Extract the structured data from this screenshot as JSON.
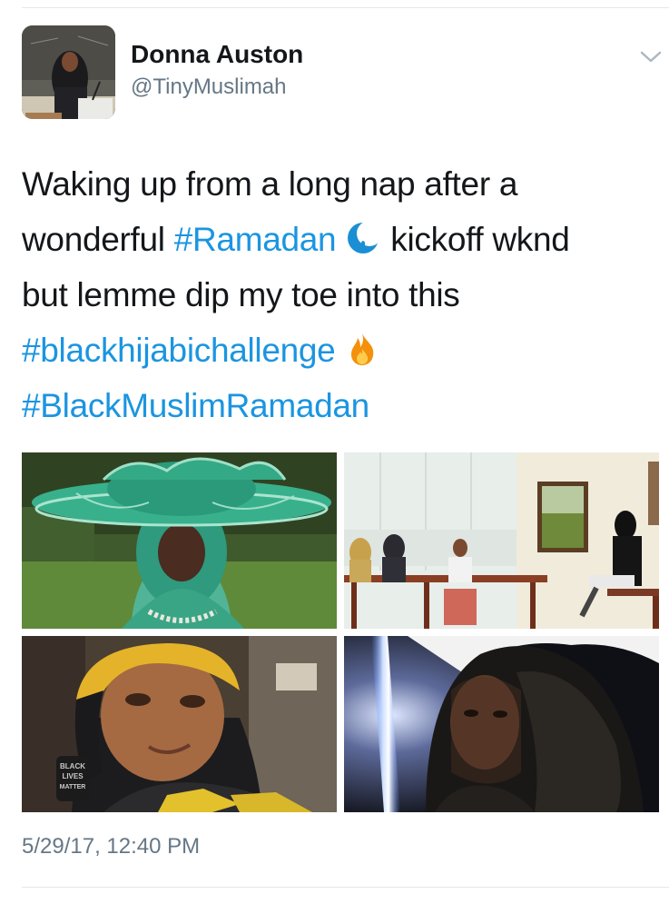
{
  "author": {
    "display_name": "Donna Auston",
    "handle": "@TinyMuslimah"
  },
  "tweet": {
    "line1": "Waking up from a long nap after a",
    "line2_pre": "wonderful ",
    "line2_hashtag": "#Ramadan",
    "line2_post": " kickoff wknd",
    "line3": "but lemme dip my toe into this",
    "line4_hashtag": "#blackhijabichallenge",
    "line5_hashtag": "#BlackMuslimRamadan",
    "emojis": [
      "crescent-moon-mosque-icon",
      "fire-icon"
    ]
  },
  "media": {
    "photo4_patch_text": "BLACK LIVES MATTER"
  },
  "timestamp": "5/29/17, 12:40 PM",
  "colors": {
    "text": "#14171a",
    "secondary": "#657786",
    "hashtag": "#1b95e0",
    "divider": "#e1e8ed"
  }
}
